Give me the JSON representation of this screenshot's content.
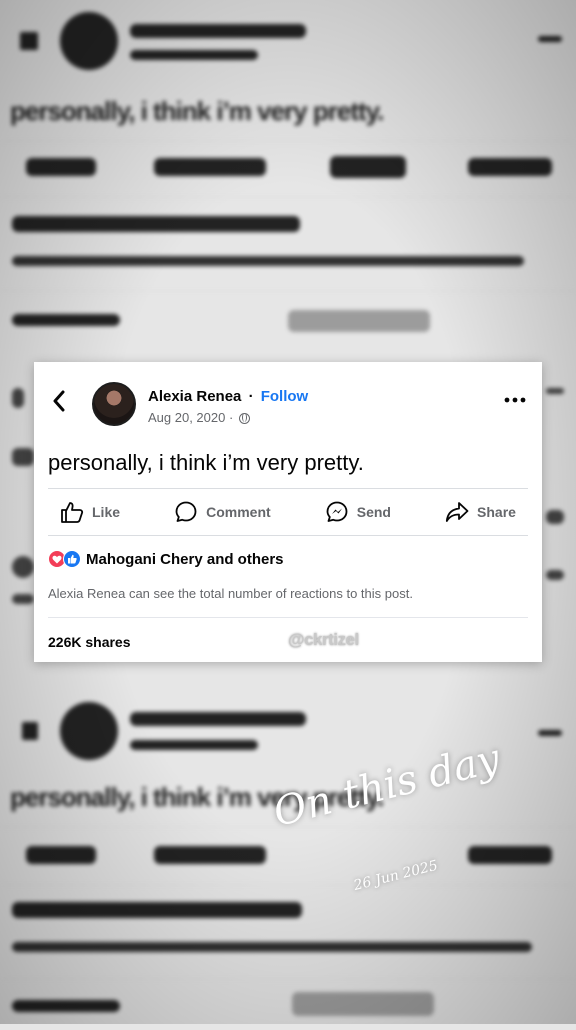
{
  "post": {
    "author": "Alexia Renea",
    "separator": "·",
    "follow_label": "Follow",
    "date": "Aug 20, 2020 ·",
    "text": "personally, i think i’m very pretty.",
    "actions": {
      "like": "Like",
      "comment": "Comment",
      "send": "Send",
      "share": "Share"
    },
    "reactions_label": "Mahogani Chery and others",
    "reactions_notice": "Alexia Renea can see the total number of reactions to this post.",
    "shares_label": "226K shares",
    "watermark": "@ckrtizel"
  },
  "overlay": {
    "title": "On this day",
    "date": "26 Jun 2025"
  },
  "colors": {
    "follow": "#1877f2",
    "heart": "#f33e58",
    "like": "#1877f2"
  },
  "icons": [
    "back-arrow-icon",
    "globe-icon",
    "more-options-icon",
    "like-icon",
    "comment-icon",
    "send-icon",
    "share-icon",
    "heart-reaction-icon",
    "like-reaction-icon"
  ]
}
